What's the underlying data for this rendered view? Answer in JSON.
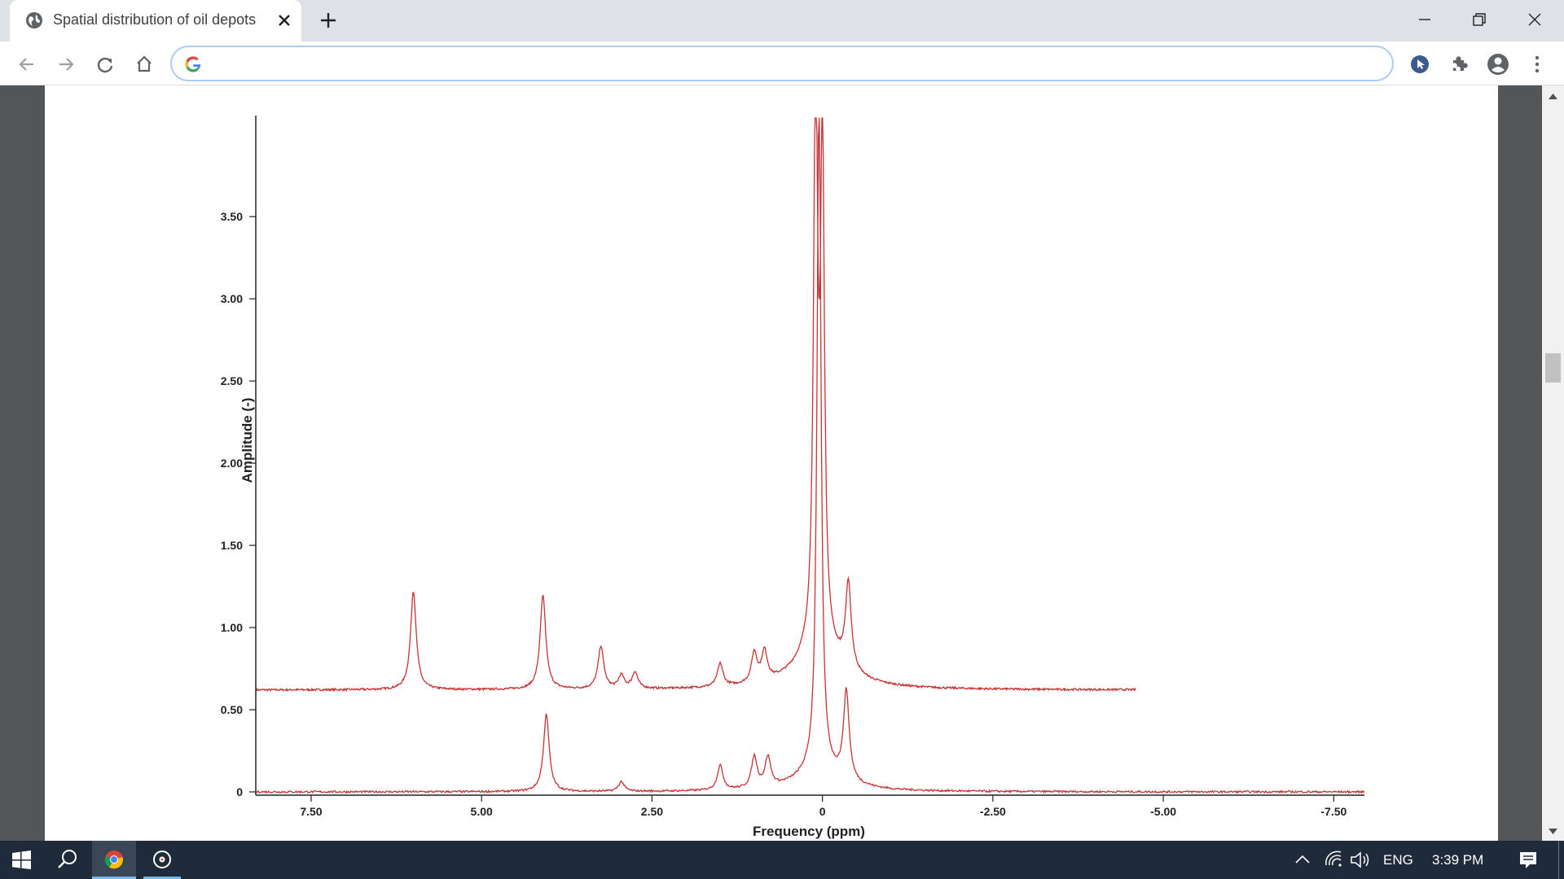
{
  "browser": {
    "tab_title": "Spatial distribution of oil depots",
    "address_value": "",
    "icons": [
      "globe-icon",
      "close-icon",
      "plus-icon",
      "back-icon",
      "forward-icon",
      "reload-icon",
      "home-icon",
      "google-icon",
      "extension-cursor-icon",
      "puzzle-icon",
      "account-icon",
      "kebab-menu-icon"
    ]
  },
  "chart_data": {
    "type": "line",
    "xlabel": "Frequency (ppm)",
    "ylabel": "Amplitude (-)",
    "x_reversed": true,
    "xlim": [
      8.3,
      -7.95
    ],
    "ylim": [
      0,
      4.1
    ],
    "x_ticks": [
      7.5,
      5.0,
      2.5,
      0,
      -2.5,
      -5.0,
      -7.5
    ],
    "x_tick_labels": [
      "7.50",
      "5.00",
      "2.50",
      "0",
      "-2.50",
      "-5.00",
      "-7.50"
    ],
    "y_ticks": [
      0,
      0.5,
      1.0,
      1.5,
      2.0,
      2.5,
      3.0,
      3.5
    ],
    "y_tick_labels": [
      "0",
      "0.50",
      "1.00",
      "1.50",
      "2.00",
      "2.50",
      "3.00",
      "3.50"
    ],
    "grid": false,
    "color": "#c83232",
    "series": [
      {
        "x_range": [
          8.3,
          -4.6
        ],
        "baseline": 0.62,
        "peaks": [
          {
            "x": 6.0,
            "y": 1.22
          },
          {
            "x": 4.1,
            "y": 1.19
          },
          {
            "x": 3.25,
            "y": 0.88
          },
          {
            "x": 2.95,
            "y": 0.7
          },
          {
            "x": 2.75,
            "y": 0.72
          },
          {
            "x": 1.5,
            "y": 0.76
          },
          {
            "x": 1.0,
            "y": 0.8
          },
          {
            "x": 0.85,
            "y": 0.8
          },
          {
            "x": 0.1,
            "y": 4.1
          },
          {
            "x": 0.0,
            "y": 3.6
          },
          {
            "x": -0.38,
            "y": 1.14
          }
        ]
      },
      {
        "x_range": [
          8.3,
          -7.95
        ],
        "baseline": 0.0,
        "peaks": [
          {
            "x": 4.05,
            "y": 0.47
          },
          {
            "x": 2.95,
            "y": 0.06
          },
          {
            "x": 1.5,
            "y": 0.15
          },
          {
            "x": 1.0,
            "y": 0.19
          },
          {
            "x": 0.8,
            "y": 0.18
          },
          {
            "x": 0.05,
            "y": 4.1
          },
          {
            "x": -0.35,
            "y": 0.54
          }
        ]
      }
    ]
  },
  "taskbar": {
    "lang": "ENG",
    "time": "3:39 PM",
    "icons": [
      "windows-start-icon",
      "search-icon",
      "chrome-icon",
      "media-player-icon",
      "chevron-up-icon",
      "wifi-icon",
      "volume-icon",
      "notification-icon"
    ]
  }
}
